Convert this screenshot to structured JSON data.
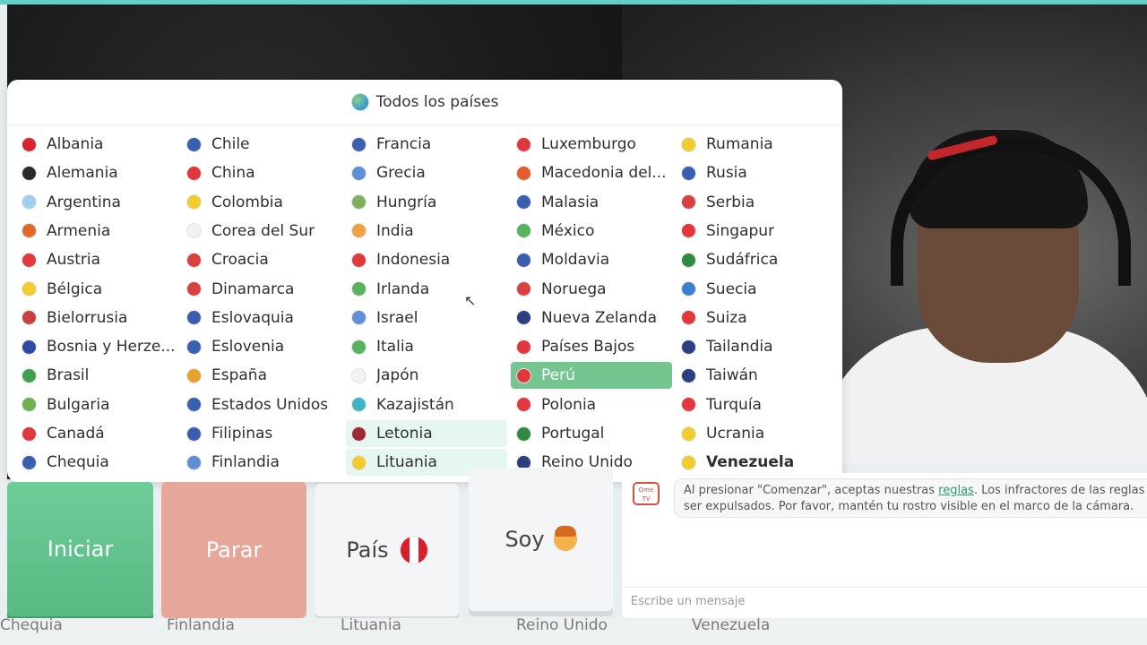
{
  "popup": {
    "title": "Todos los países",
    "columns": [
      [
        {
          "name": "Albania",
          "flag": "#d8262e"
        },
        {
          "name": "Alemania",
          "flag": "#2b2b2b"
        },
        {
          "name": "Argentina",
          "flag": "#9fd1ee"
        },
        {
          "name": "Armenia",
          "flag": "#e06a2c"
        },
        {
          "name": "Austria",
          "flag": "#e0383c"
        },
        {
          "name": "Bélgica",
          "flag": "#f0cc2e"
        },
        {
          "name": "Bielorrusia",
          "flag": "#c9403f"
        },
        {
          "name": "Bosnia y Herze...",
          "flag": "#2d4aa0"
        },
        {
          "name": "Brasil",
          "flag": "#3fa150"
        },
        {
          "name": "Bulgaria",
          "flag": "#6fb04f"
        },
        {
          "name": "Canadá",
          "flag": "#e0383c"
        },
        {
          "name": "Chequia",
          "flag": "#3b5fb0"
        }
      ],
      [
        {
          "name": "Chile",
          "flag": "#3b5fb0"
        },
        {
          "name": "China",
          "flag": "#e0383c"
        },
        {
          "name": "Colombia",
          "flag": "#f0cc2e"
        },
        {
          "name": "Corea del Sur",
          "flag": "#f2f2f2"
        },
        {
          "name": "Croacia",
          "flag": "#d94040"
        },
        {
          "name": "Dinamarca",
          "flag": "#d94040"
        },
        {
          "name": "Eslovaquia",
          "flag": "#3b5fb0"
        },
        {
          "name": "Eslovenia",
          "flag": "#3b5fb0"
        },
        {
          "name": "España",
          "flag": "#e6a22e"
        },
        {
          "name": "Estados Unidos",
          "flag": "#3b5fb0"
        },
        {
          "name": "Filipinas",
          "flag": "#3b5fb0"
        },
        {
          "name": "Finlandia",
          "flag": "#5f8fd6"
        }
      ],
      [
        {
          "name": "Francia",
          "flag": "#3b5fb0"
        },
        {
          "name": "Grecia",
          "flag": "#5f8fd6"
        },
        {
          "name": "Hungría",
          "flag": "#7fb05f"
        },
        {
          "name": "India",
          "flag": "#f0a040"
        },
        {
          "name": "Indonesia",
          "flag": "#e0383c"
        },
        {
          "name": "Irlanda",
          "flag": "#58b35f"
        },
        {
          "name": "Israel",
          "flag": "#5f8fd6"
        },
        {
          "name": "Italia",
          "flag": "#58b35f"
        },
        {
          "name": "Japón",
          "flag": "#f2f2f2"
        },
        {
          "name": "Kazajistán",
          "flag": "#3fb3c6"
        },
        {
          "name": "Letonia",
          "flag": "#9e2a36",
          "state": "light"
        },
        {
          "name": "Lituania",
          "flag": "#f0cc2e",
          "state": "light"
        }
      ],
      [
        {
          "name": "Luxemburgo",
          "flag": "#e0383c"
        },
        {
          "name": "Macedonia del...",
          "flag": "#e65a2e"
        },
        {
          "name": "Malasia",
          "flag": "#3b5fb0"
        },
        {
          "name": "México",
          "flag": "#58b35f"
        },
        {
          "name": "Moldavia",
          "flag": "#3b5fb0"
        },
        {
          "name": "Noruega",
          "flag": "#d94040"
        },
        {
          "name": "Nueva Zelanda",
          "flag": "#2b3f80"
        },
        {
          "name": "Países Bajos",
          "flag": "#e0383c"
        },
        {
          "name": "Perú",
          "flag": "#e0383c",
          "state": "selected"
        },
        {
          "name": "Polonia",
          "flag": "#e0383c"
        },
        {
          "name": "Portugal",
          "flag": "#2e8a3e"
        },
        {
          "name": "Reino Unido",
          "flag": "#2b3f80"
        }
      ],
      [
        {
          "name": "Rumania",
          "flag": "#f0cc2e"
        },
        {
          "name": "Rusia",
          "flag": "#3b5fb0"
        },
        {
          "name": "Serbia",
          "flag": "#d94040"
        },
        {
          "name": "Singapur",
          "flag": "#e0383c"
        },
        {
          "name": "Sudáfrica",
          "flag": "#2e8a3e"
        },
        {
          "name": "Suecia",
          "flag": "#3b7fd0"
        },
        {
          "name": "Suiza",
          "flag": "#e0383c"
        },
        {
          "name": "Tailandia",
          "flag": "#2b3f80"
        },
        {
          "name": "Taiwán",
          "flag": "#2b3f80"
        },
        {
          "name": "Turquía",
          "flag": "#e0383c"
        },
        {
          "name": "Ucrania",
          "flag": "#f0cc2e"
        },
        {
          "name": "Venezuela",
          "flag": "#f0cc2e",
          "state": "bold"
        }
      ]
    ]
  },
  "buttons": {
    "start": "Iniciar",
    "stop": "Parar",
    "country": "País",
    "gender": "Soy"
  },
  "chat": {
    "logo": "Ome TV",
    "message_before": "Al presionar \"Comenzar\", aceptas nuestras ",
    "message_link": "reglas",
    "message_after": ". Los infractores de las reglas ser expulsados. Por favor, mantén tu rostro visible en el marco de la cámara.",
    "input_placeholder": "Escribe un mensaje"
  },
  "under_list": [
    "Chequia",
    "Finlandia",
    "Lituania",
    "Reino Unido",
    "Venezuela"
  ]
}
